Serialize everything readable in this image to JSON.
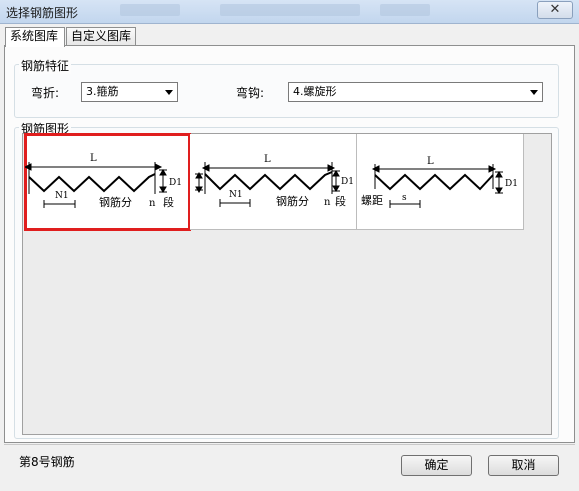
{
  "window": {
    "title": "选择钢筋图形",
    "close_glyph": "✕"
  },
  "tabs": [
    {
      "label": "系统图库",
      "active": true
    },
    {
      "label": "自定义图库",
      "active": false
    }
  ],
  "features": {
    "group_label": "钢筋特征",
    "bend": {
      "label": "弯折:",
      "value": "3.箍筋"
    },
    "hook": {
      "label": "弯钩:",
      "value": "4.螺旋形"
    }
  },
  "shapes": {
    "group_label": "钢筋图形",
    "items": [
      {
        "length": "L",
        "height": "D1",
        "pitch": "N1",
        "note": "钢筋分",
        "count": "n",
        "unit": "段",
        "selected": true
      },
      {
        "length": "L",
        "height": "D1",
        "pitch": "N1",
        "note": "钢筋分",
        "count": "n",
        "unit": "段",
        "selected": false
      },
      {
        "length": "L",
        "height": "D1",
        "pitch_label": "螺距",
        "pitch": "s",
        "selected": false
      }
    ]
  },
  "status": "第8号钢筋",
  "buttons": {
    "ok": "确定",
    "cancel": "取消"
  }
}
